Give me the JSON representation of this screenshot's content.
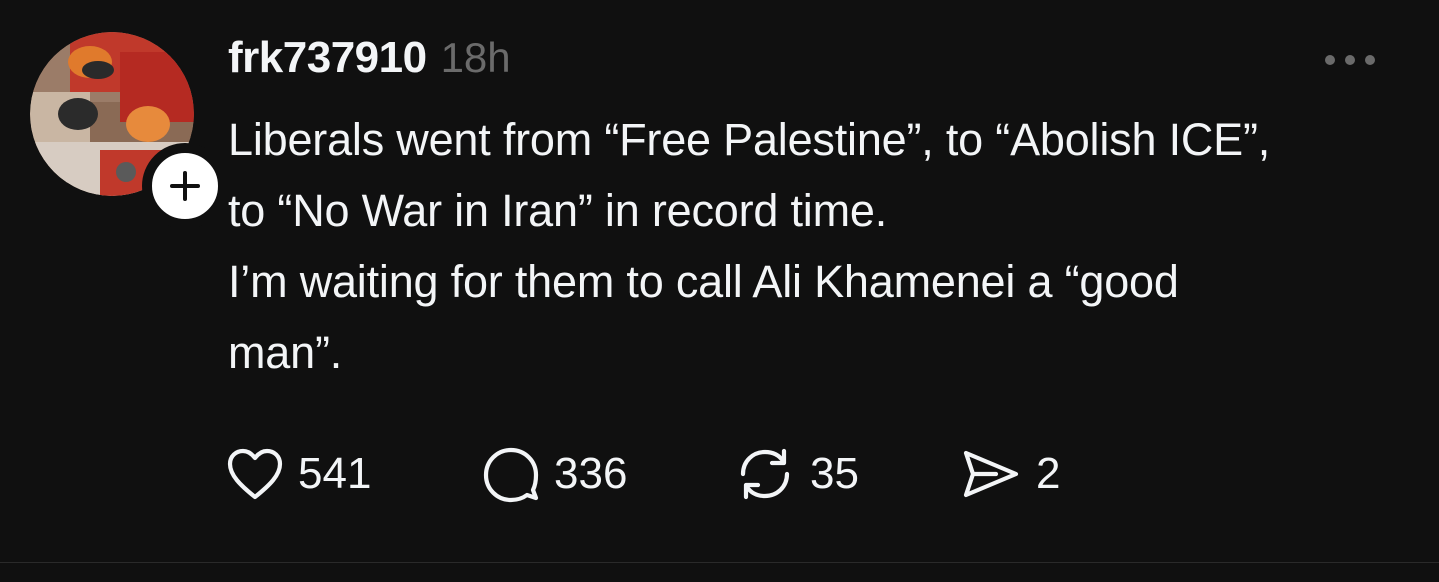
{
  "post": {
    "username": "frk737910",
    "timestamp": "18h",
    "text_lines": [
      "Liberals went from “Free Palestine”, to “Abolish ICE”,",
      "to “No War in Iran” in record time.",
      "I’m waiting for them to call Ali Khamenei a “good",
      "man”."
    ],
    "avatar_icon": "profile-photo",
    "follow_icon": "plus-icon",
    "more_icon": "more-dots-icon"
  },
  "actions": {
    "likes": "541",
    "replies": "336",
    "reposts": "35",
    "shares": "2"
  },
  "colors": {
    "background": "#101010",
    "text": "#f3f5f7",
    "muted": "#6b6b6b",
    "divider": "#2a2a2a"
  }
}
